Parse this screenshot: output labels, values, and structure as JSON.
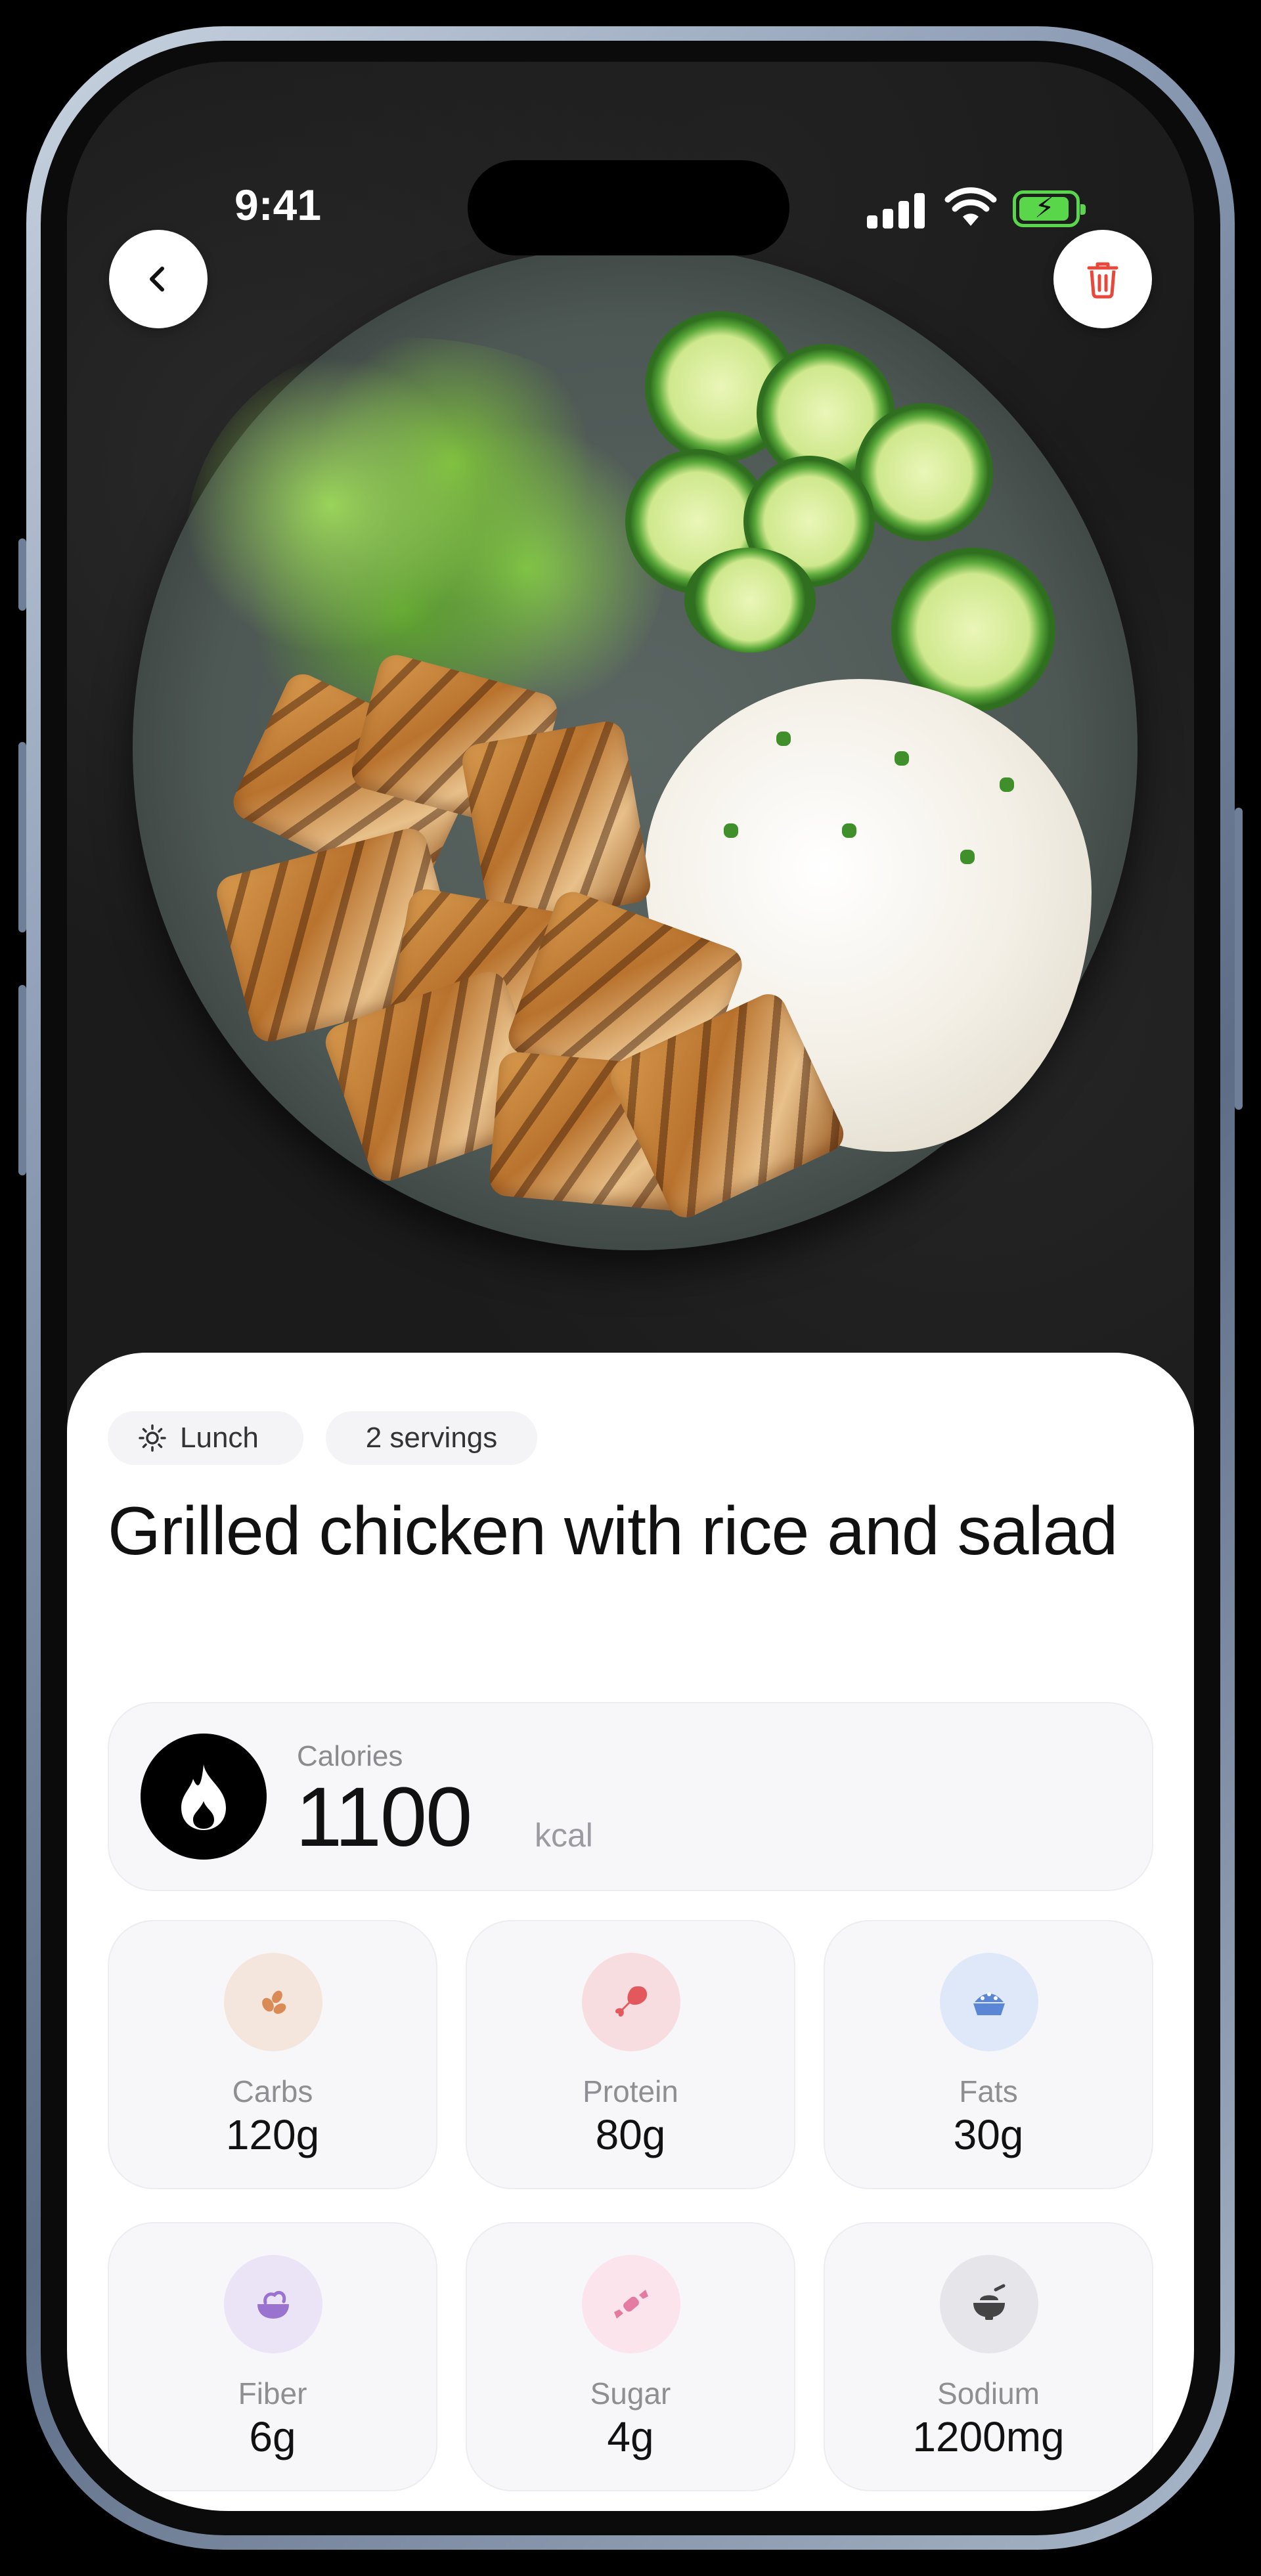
{
  "status_bar": {
    "time": "9:41"
  },
  "header": {
    "back_icon": "chevron-left-icon",
    "delete_icon": "trash-icon"
  },
  "meal": {
    "meal_type": "Lunch",
    "meal_type_icon": "sun-icon",
    "servings": "2 servings",
    "title": "Grilled chicken with rice and salad"
  },
  "calories": {
    "label": "Calories",
    "value": "1100",
    "unit": "kcal",
    "icon": "flame-icon"
  },
  "nutrients": [
    {
      "label": "Carbs",
      "value": "120g",
      "icon": "grain-icon",
      "color": "#f4e6dc",
      "icon_color": "#d98a55"
    },
    {
      "label": "Protein",
      "value": "80g",
      "icon": "drumstick-icon",
      "color": "#f8dde0",
      "icon_color": "#e2585d"
    },
    {
      "label": "Fats",
      "value": "30g",
      "icon": "pie-icon",
      "color": "#dfe8f8",
      "icon_color": "#5b86d6"
    },
    {
      "label": "Fiber",
      "value": "6g",
      "icon": "salad-bowl-icon",
      "color": "#ebe3f6",
      "icon_color": "#9a72d0"
    },
    {
      "label": "Sugar",
      "value": "4g",
      "icon": "candy-icon",
      "color": "#fbe4ec",
      "icon_color": "#e37ca0"
    },
    {
      "label": "Sodium",
      "value": "1200mg",
      "icon": "salt-bowl-icon",
      "color": "#e6e6ea",
      "icon_color": "#444444"
    }
  ]
}
